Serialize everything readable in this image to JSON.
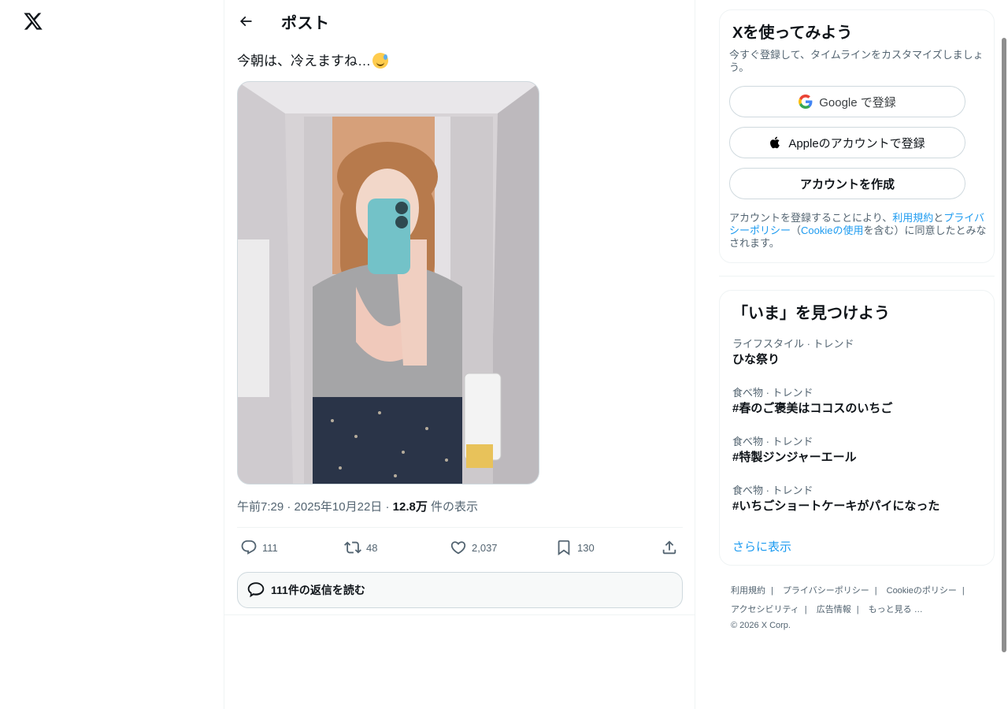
{
  "header": {
    "title": "ポスト"
  },
  "post": {
    "text": "今朝は、冷えますね…",
    "time": "午前7:29",
    "date": "2025年10月22日",
    "views_count": "12.8万",
    "views_label": "件の表示",
    "replies": "111",
    "reposts": "48",
    "likes": "2,037",
    "bookmarks": "130",
    "read_replies": "111件の返信を読む"
  },
  "signup": {
    "title": "Xを使ってみよう",
    "subtitle": "今すぐ登録して、タイムラインをカスタマイズしましょう。",
    "google_label": "Google で登録",
    "apple_label": "Appleのアカウントで登録",
    "create_label": "アカウントを作成",
    "terms_prefix": "アカウントを登録することにより、",
    "terms_link": "利用規約",
    "terms_and": "と",
    "privacy_link": "プライバシーポリシー",
    "paren_open": "（",
    "cookie_link": "Cookieの使用",
    "terms_suffix": "を含む）に同意したとみなされます。"
  },
  "trends": {
    "title": "「いま」を見つけよう",
    "items": [
      {
        "category": "ライフスタイル · トレンド",
        "name": "ひな祭り"
      },
      {
        "category": "食べ物 · トレンド",
        "name": "#春のご褒美はココスのいちご"
      },
      {
        "category": "食べ物 · トレンド",
        "name": "#特製ジンジャーエール"
      },
      {
        "category": "食べ物 · トレンド",
        "name": "#いちごショートケーキがパイになった"
      }
    ],
    "show_more": "さらに表示"
  },
  "footer": {
    "links": [
      "利用規約",
      "プライバシーポリシー",
      "Cookieのポリシー",
      "アクセシビリティ",
      "広告情報",
      "もっと見る …"
    ],
    "copyright": "© 2026 X Corp."
  },
  "colors": {
    "accent": "#1d9bf0",
    "text": "#0f1419",
    "muted": "#536471",
    "border": "#cfd9de"
  },
  "icons": [
    "x-logo-icon",
    "back-arrow-icon",
    "reply-icon",
    "repost-icon",
    "like-icon",
    "bookmark-icon",
    "share-icon",
    "google-icon",
    "apple-icon",
    "chat-bubble-icon"
  ]
}
